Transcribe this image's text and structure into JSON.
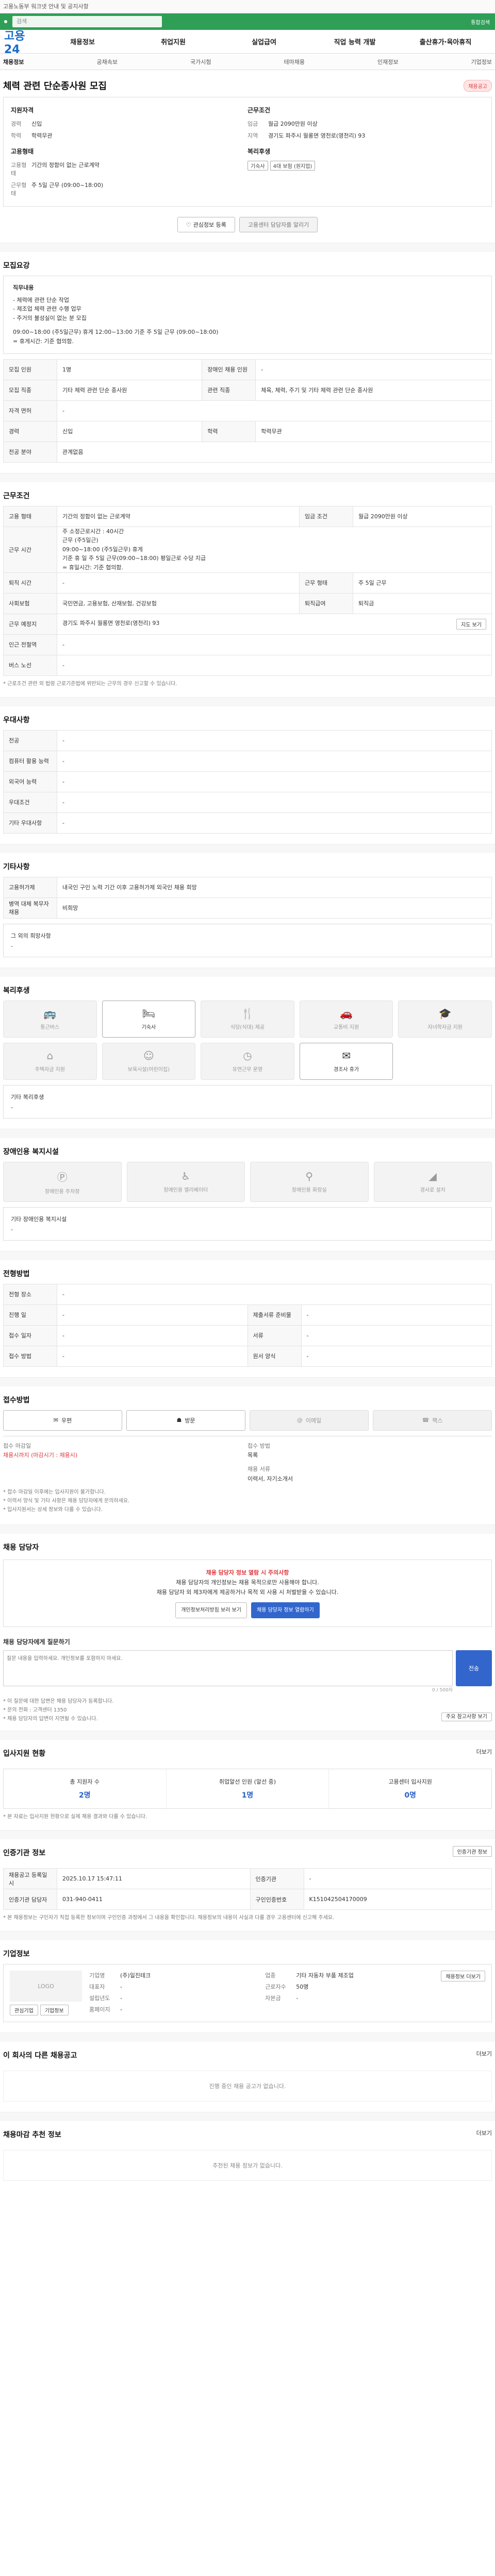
{
  "top": {
    "notice": "고용노동부 워크넷 안내 및 공지사항",
    "search_placeholder": "검색",
    "search_link": "통합검색"
  },
  "header": {
    "logo": "고용24",
    "gnb": [
      "채용정보",
      "취업지원",
      "실업급여",
      "직업 능력 개발",
      "출산휴가·육아휴직"
    ]
  },
  "tabs": [
    "채용정보",
    "공채속보",
    "국가시험",
    "테마채용",
    "인재정보",
    "기업정보"
  ],
  "job": {
    "title": "체력 관련 단순종사원 모집",
    "badge": "채용공고",
    "left_head": "지원자격",
    "left_rows": [
      {
        "k": "경력",
        "v": "신입"
      },
      {
        "k": "학력",
        "v": "학력무관"
      }
    ],
    "left_head2": "고용형태",
    "left_rows2": [
      {
        "k": "고용형태",
        "v": "기간의 정함이 없는 근로계약"
      },
      {
        "k": "근무형태",
        "v": "주 5일 근무 (09:00~18:00)"
      }
    ],
    "right_head": "근무조건",
    "right_rows": [
      {
        "k": "임금",
        "v": "월급 2090만원 이상"
      },
      {
        "k": "지역",
        "v": "경기도 파주시 월롱면 영천로(영천리) 93"
      }
    ],
    "right_head2": "복리후생",
    "tags": [
      "기숙사",
      "4대 보험 (원지업)"
    ]
  },
  "actions": {
    "scrap": "관심정보 등록",
    "alarm": "고용센터 담당자를 알리기"
  },
  "sections": {
    "job_summary": "모집요강",
    "conditions": "근무조건",
    "qualify": "우대사항",
    "other": "기타사항",
    "welfare": "복리후생",
    "disability": "장애인용 복지시설",
    "apply": "전형방법",
    "apply_method": "접수방법",
    "manager": "채용 담당자",
    "inquiry_stats": "입사지원 현황",
    "contact_info": "인증기관 정보",
    "company": "기업정보",
    "similar": "이 회사의 다른 채용공고",
    "region_jobs": "채용마감 추천 정보"
  },
  "summary_desc": {
    "head": "직무내용",
    "lines": [
      "- 체력에 관련 단순 작업",
      "- 제조업 체력 관련 수행 업무",
      "- 주거의 불성실이 없는 분 모집",
      "",
      "09:00~18:00 (주5일근무) 휴게 12:00~13:00 기준 주 5일 근무 (09:00~18:00)",
      "= 휴게시간: 기준 협의함."
    ]
  },
  "summary_table": [
    [
      "모집 인원",
      "1명",
      "장애인 채용 인원",
      "-"
    ],
    [
      "모집 직종",
      "기타 체력 관련 단순 종사원",
      "관련 직종",
      "체육, 체력, 주기 및 기타 체력 관련 단순 종사원"
    ],
    [
      "자격 면허",
      "-",
      "",
      ""
    ],
    [
      "경력",
      "신입",
      "학력",
      "학력무관"
    ],
    [
      "전공 분야",
      "관계없음",
      "",
      ""
    ]
  ],
  "cond_table": [
    [
      "고용 형태",
      "기간의 정함이 없는 근로계약",
      "임금 조건",
      "월급 2090만원 이상"
    ],
    [
      "근무 시간",
      "주 소정근로시간 : 40시간",
      "",
      ""
    ],
    [
      "퇴직 시간",
      "-",
      "근무 형태",
      "주 5일 근무"
    ],
    [
      "사회보험",
      "국민연금, 고용보험, 산재보험, 건강보험",
      "퇴직급여",
      "퇴직금"
    ],
    [
      "근무 예정지",
      "경기도 파주시 월롱면 영천로(영천리) 93",
      "",
      ""
    ],
    [
      "인근 전철역",
      "-",
      "",
      ""
    ],
    [
      "버스 노선",
      "-",
      "",
      ""
    ]
  ],
  "work_hours_detail": [
    "근무 (주5일근)",
    "09:00~18:00 (주5일근무) 휴게",
    "기준 휴 일 주 5일 근무(09:00~18:00) 평일근로 수당 지급",
    "= 휴일시간: 기준 협의함."
  ],
  "map_button": "지도 보기",
  "cond_note": "* 근로조건 관련 외 법령 근로기준법에 위반되는 근무의 경우 신고할 수 있습니다.",
  "pref_table": [
    [
      "전공",
      "-"
    ],
    [
      "컴퓨터 활용 능력",
      "-"
    ],
    [
      "외국어 능력",
      "-"
    ],
    [
      "우대조건",
      "-"
    ],
    [
      "기타 우대사항",
      "-"
    ]
  ],
  "other_table": [
    [
      "고용허가제",
      "내국인 구인 노력 기간 이후 고용허가제 외국인 채용 희망"
    ],
    [
      "병역 대체 복무자 채용",
      "비희망"
    ]
  ],
  "other_box": "그 외의 희망사항",
  "other_box_val": "-",
  "welfare_items": [
    {
      "icon": "building-icon",
      "label": "통근버스",
      "on": false
    },
    {
      "icon": "bed-icon",
      "label": "기숙사",
      "on": true
    },
    {
      "icon": "meal-icon",
      "label": "식당(식대) 제공",
      "on": false
    },
    {
      "icon": "car-icon",
      "label": "교통비 지원",
      "on": false
    },
    {
      "icon": "hat-icon",
      "label": "자녀학자금 지원",
      "on": false
    },
    {
      "icon": "house-icon",
      "label": "주택자금 지원",
      "on": false
    },
    {
      "icon": "child-icon",
      "label": "보육시설(어린이집)",
      "on": false
    },
    {
      "icon": "clock-icon",
      "label": "유연근무 운영",
      "on": false
    },
    {
      "icon": "gift-icon",
      "label": "경조사 휴가",
      "on": true
    }
  ],
  "welfare_other_label": "기타 복리후생",
  "welfare_other_val": "-",
  "disability_items": [
    {
      "icon": "parking-icon",
      "label": "장애인용 주차장"
    },
    {
      "icon": "wheelchair-icon",
      "label": "장애인용 엘리베이터"
    },
    {
      "icon": "toilet-icon",
      "label": "장애인용 화장실"
    },
    {
      "icon": "ramp-icon",
      "label": "경사로 설치"
    }
  ],
  "disability_other_label": "기타 장애인용 복지시설",
  "disability_other_val": "-",
  "apply_table": [
    [
      "전형 장소",
      "-",
      "",
      ""
    ],
    [
      "진행 일",
      "-",
      "제출서류 준비물",
      "-"
    ],
    [
      "접수 일자",
      "-",
      "서류",
      "-"
    ],
    [
      "접수 방법",
      "-",
      "원서 양식",
      "-"
    ]
  ],
  "apply_buttons": [
    {
      "icon": "mail-icon",
      "label": "우편",
      "on": true
    },
    {
      "icon": "person-icon",
      "label": "방문",
      "on": true
    },
    {
      "icon": "email-icon",
      "label": "이메일",
      "on": false
    },
    {
      "icon": "fax-icon",
      "label": "팩스",
      "on": false
    }
  ],
  "papers": {
    "col1_title": "접수 마감일",
    "col1_val": "채용시까지 (마감시기 : 채용시)",
    "col2_title": "접수 방법",
    "col2_val": "목록",
    "col3_title": "채용 서류",
    "col3_val": "이력서, 자기소개서"
  },
  "warn_lines": [
    "* 접수 마감일 이후에는 입사지원이 불가합니다.",
    "* 이력서 양식 및 기타 사항은 채용 담당자에게 문의하세요.",
    "* 입사지원서는 상세 정보와 다를 수 있습니다."
  ],
  "manager": {
    "red": "채용 담당자 정보 열람 시 주의사항",
    "l1": "채용 담당자의 개인정보는 채용 목적으로만 사용해야 합니다.",
    "l2": "채용 담당자 외 제3자에게 제공하거나 목적 외 사용 시 처벌받을 수 있습니다.",
    "btn1": "개인정보처리방침 보러 보기",
    "btn2": "채용 담당자 정보 열람하기"
  },
  "inquiry": {
    "label": "채용 담당자에게 질문하기",
    "placeholder": "질문 내용을 입력하세요. 개인정보를 포함하지 마세요.",
    "send": "전송",
    "count": "0 / 500자",
    "notes": [
      "* 이 질문에 대한 답변은 채용 담당자가 등록합니다.",
      "* 문의 전화 : 고객센터 1350",
      "* 채용 담당자의 답변이 지연될 수 있습니다."
    ],
    "notice_btn": "주요 참고사항 보기"
  },
  "stats": {
    "more": "더보기",
    "items": [
      {
        "label": "총 지원자 수",
        "val": "2명"
      },
      {
        "label": "취업알선 인원 (알선 중)",
        "val": "1명"
      },
      {
        "label": "고용센터 입사지원",
        "val": "0명"
      }
    ],
    "note": "* 본 자료는 입사지원 현황으로 실제 채용 결과와 다를 수 있습니다."
  },
  "reg": {
    "btn": "인증기관 정보",
    "rows": [
      [
        "채용공고 등록일시",
        "2025.10.17 15:47:11",
        "인증기관",
        "-"
      ],
      [
        "인증기관 담당자",
        "031-940-0411",
        "구인인증번호",
        "K151042504170009"
      ]
    ],
    "note": "* 본 채용정보는 구인자가 직접 등록한 정보이며 구인인증 과정에서 그 내용을 확인합니다. 채용정보의 내용이 사실과 다를 경우 고용센터에 신고해 주세요."
  },
  "company": {
    "logo": "LOGO",
    "btns": [
      "관심기업",
      "기업정보"
    ],
    "rows": [
      [
        "기업명",
        "(주)일진테크",
        "업종",
        "기타 자동차 부품 제조업"
      ],
      [
        "대표자",
        "-",
        "근로자수",
        "50명"
      ],
      [
        "설립년도",
        "-",
        "자본금",
        "-"
      ],
      [
        "홈페이지",
        "-",
        "",
        ""
      ]
    ],
    "detail_btn": "채용정보 더보기"
  },
  "similar": {
    "more": "더보기",
    "empty": "진행 중인 채용 공고가 없습니다."
  },
  "region": {
    "more": "더보기",
    "empty": "추천된 채용 정보가 없습니다."
  }
}
